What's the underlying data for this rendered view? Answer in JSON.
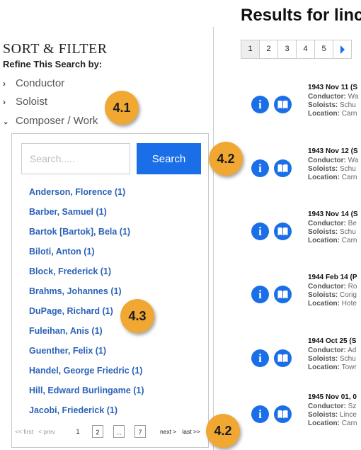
{
  "sidebar": {
    "title": "SORT & FILTER",
    "refine": "Refine This Search by:",
    "facets": [
      {
        "label": "Conductor",
        "chevron": "›",
        "expanded": false
      },
      {
        "label": "Soloist",
        "chevron": "›",
        "expanded": false
      },
      {
        "label": "Composer / Work",
        "chevron": "⌄",
        "expanded": true
      }
    ],
    "search": {
      "placeholder": "Search.....",
      "button": "Search"
    },
    "composers": [
      "Anderson, Florence (1)",
      "Barber, Samuel (1)",
      "Bartok [Bartok], Bela (1)",
      "Biloti, Anton (1)",
      "Block, Frederick (1)",
      "Brahms, Johannes (1)",
      "DuPage, Richard (1)",
      "Fuleihan, Anis (1)",
      "Guenther, Felix (1)",
      "Handel, George Friedric (1)",
      "Hill, Edward Burlingame (1)",
      "Jacobi, Friederick (1)"
    ],
    "pager": {
      "first": "<< first",
      "prev": "< prev",
      "pages": [
        "1",
        "2",
        "...",
        "7"
      ],
      "next": "next >",
      "last": "last >>"
    }
  },
  "main": {
    "title": "Results for linc",
    "pagination": {
      "pages": [
        "1",
        "2",
        "3",
        "4",
        "5"
      ],
      "active": "1"
    },
    "results": [
      {
        "date": "1943 Nov 11 (S",
        "conductor": "Wa",
        "soloists": "Schu",
        "location": "Carn"
      },
      {
        "date": "1943 Nov 12 (S",
        "conductor": "Wa",
        "soloists": "Schu",
        "location": "Carn"
      },
      {
        "date": "1943 Nov 14 (S",
        "conductor": "Be",
        "soloists": "Schu",
        "location": "Carn"
      },
      {
        "date": "1944 Feb 14 (P",
        "conductor": "Ro",
        "soloists": "Corig",
        "location": "Hote"
      },
      {
        "date": "1944 Oct 25 (S",
        "conductor": "Ad",
        "soloists": "Schu",
        "location": "Towr"
      },
      {
        "date": "1945 Nov 01, 0",
        "conductor": "Sz",
        "soloists": "Lince",
        "location": "Carn"
      }
    ],
    "labels": {
      "conductor": "Conductor:",
      "soloists": "Soloists:",
      "location": "Location:"
    }
  },
  "callouts": [
    "4.1",
    "4.2",
    "4.3",
    "4.2"
  ],
  "colors": {
    "accent": "#1a6fe8",
    "link": "#2a62b8",
    "badge": "#f0a832"
  },
  "icons": {
    "info": "info-icon",
    "book": "book-icon",
    "next": "chevron-right-icon"
  }
}
